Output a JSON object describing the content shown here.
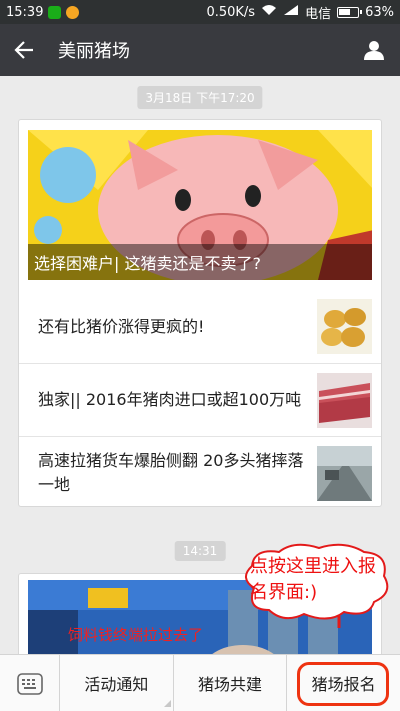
{
  "statusbar": {
    "time": "15:39",
    "speed": "0.50K/s",
    "carrier": "电信",
    "battery": "63%"
  },
  "navbar": {
    "title": "美丽猪场"
  },
  "chat": {
    "timestamp1": "3月18日 下午17:20",
    "timestamp2": "14:31",
    "news": {
      "cover_title": "选择困难户| 这猪卖还是不卖了?",
      "articles": [
        {
          "title": "还有比猪价涨得更疯的!"
        },
        {
          "title": "独家|| 2016年猪肉进口或超100万吨"
        },
        {
          "title": "高速拉猪货车爆胎侧翻 20多头猪摔落一地"
        }
      ]
    },
    "video_caption": "饲料钱终端拉过去了"
  },
  "annotation": {
    "text": "点按这里进入报名界面:)"
  },
  "menu": {
    "items": [
      "活动通知",
      "猪场共建",
      "猪场报名"
    ]
  },
  "colors": {
    "navbar": "#393a3f",
    "annotation": "#e31a1a",
    "statusbar": "#2e3132"
  }
}
